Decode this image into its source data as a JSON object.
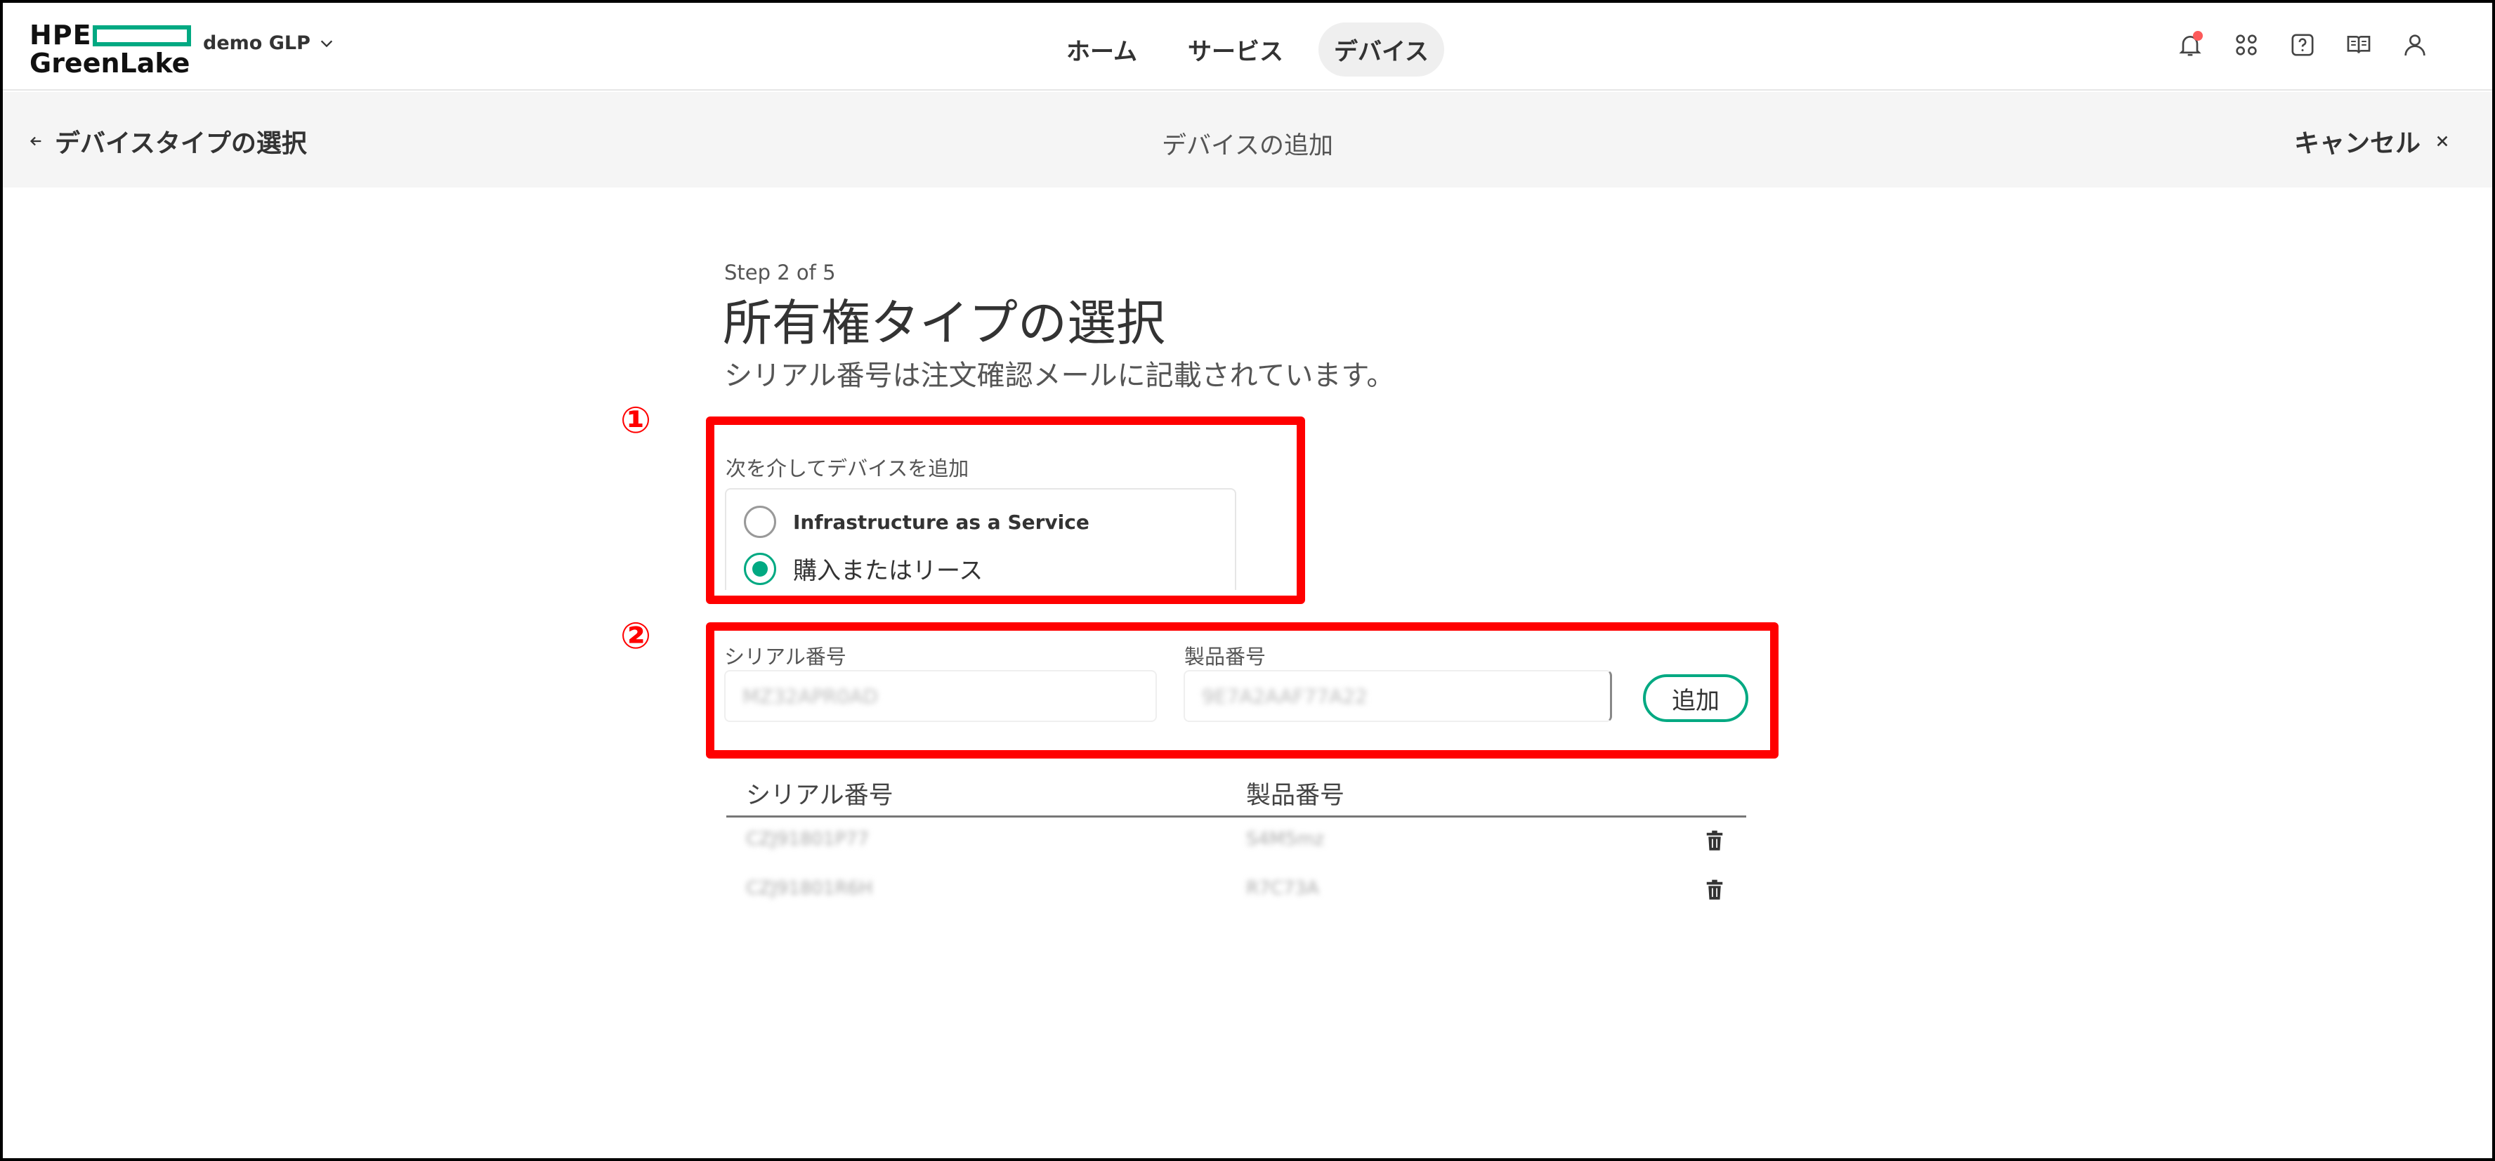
{
  "brand": {
    "hpe": "HPE",
    "greenlake": "GreenLake",
    "accent": "#01a982"
  },
  "workspace": {
    "name": "demo GLP",
    "icon": "chevron-down-icon"
  },
  "nav": {
    "items": [
      "ホーム",
      "サービス",
      "デバイス"
    ],
    "active": "デバイス"
  },
  "top_icons": [
    "bell-icon",
    "apps-grid-icon",
    "help-icon",
    "book-icon",
    "user-icon"
  ],
  "subheader": {
    "back_label": "デバイスタイプの選択",
    "title": "デバイスの追加",
    "cancel_label": "キャンセル"
  },
  "step": {
    "label": "Step 2 of 5"
  },
  "page": {
    "title": "所有権タイプの選択",
    "description": "シリアル番号は注文確認メールに記載されています。"
  },
  "ownership": {
    "group_label": "次を介してデバイスを追加",
    "options": [
      {
        "label": "Infrastructure as a Service",
        "checked": false
      },
      {
        "label": "購入またはリース",
        "checked": true
      }
    ]
  },
  "annotations": {
    "one": "①",
    "two": "②",
    "color": "#ff0000"
  },
  "form": {
    "serial_label": "シリアル番号",
    "serial_value": "MZ32APR0AD",
    "product_label": "製品番号",
    "product_value": "9E7A2AAF77A22",
    "add_label": "追加"
  },
  "table": {
    "headers": [
      "シリアル番号",
      "製品番号"
    ],
    "rows": [
      {
        "serial": "CZJ91801P77",
        "product": "S4M5mz"
      },
      {
        "serial": "CZJ91801R6H",
        "product": "R7C73A"
      }
    ]
  }
}
